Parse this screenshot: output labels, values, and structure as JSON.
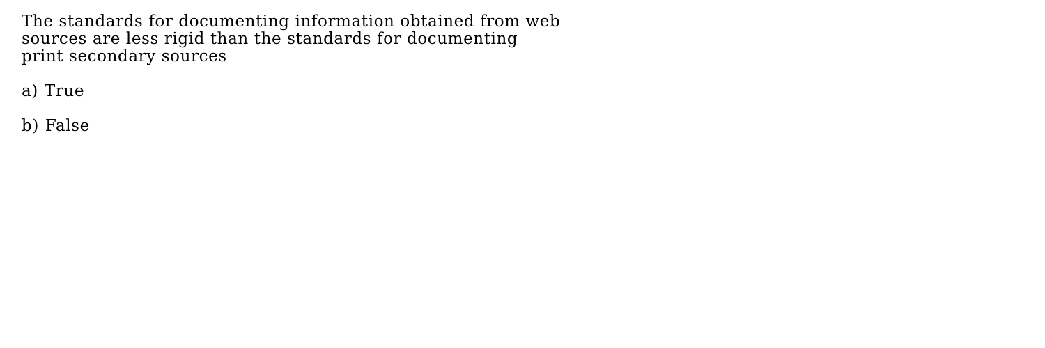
{
  "question": {
    "lines": [
      "The standards for documenting information obtained from web",
      "sources are less rigid than the standards for documenting",
      "print secondary sources"
    ]
  },
  "options": [
    {
      "letter": "a)",
      "text": "True"
    },
    {
      "letter": "b)",
      "text": "False"
    }
  ]
}
